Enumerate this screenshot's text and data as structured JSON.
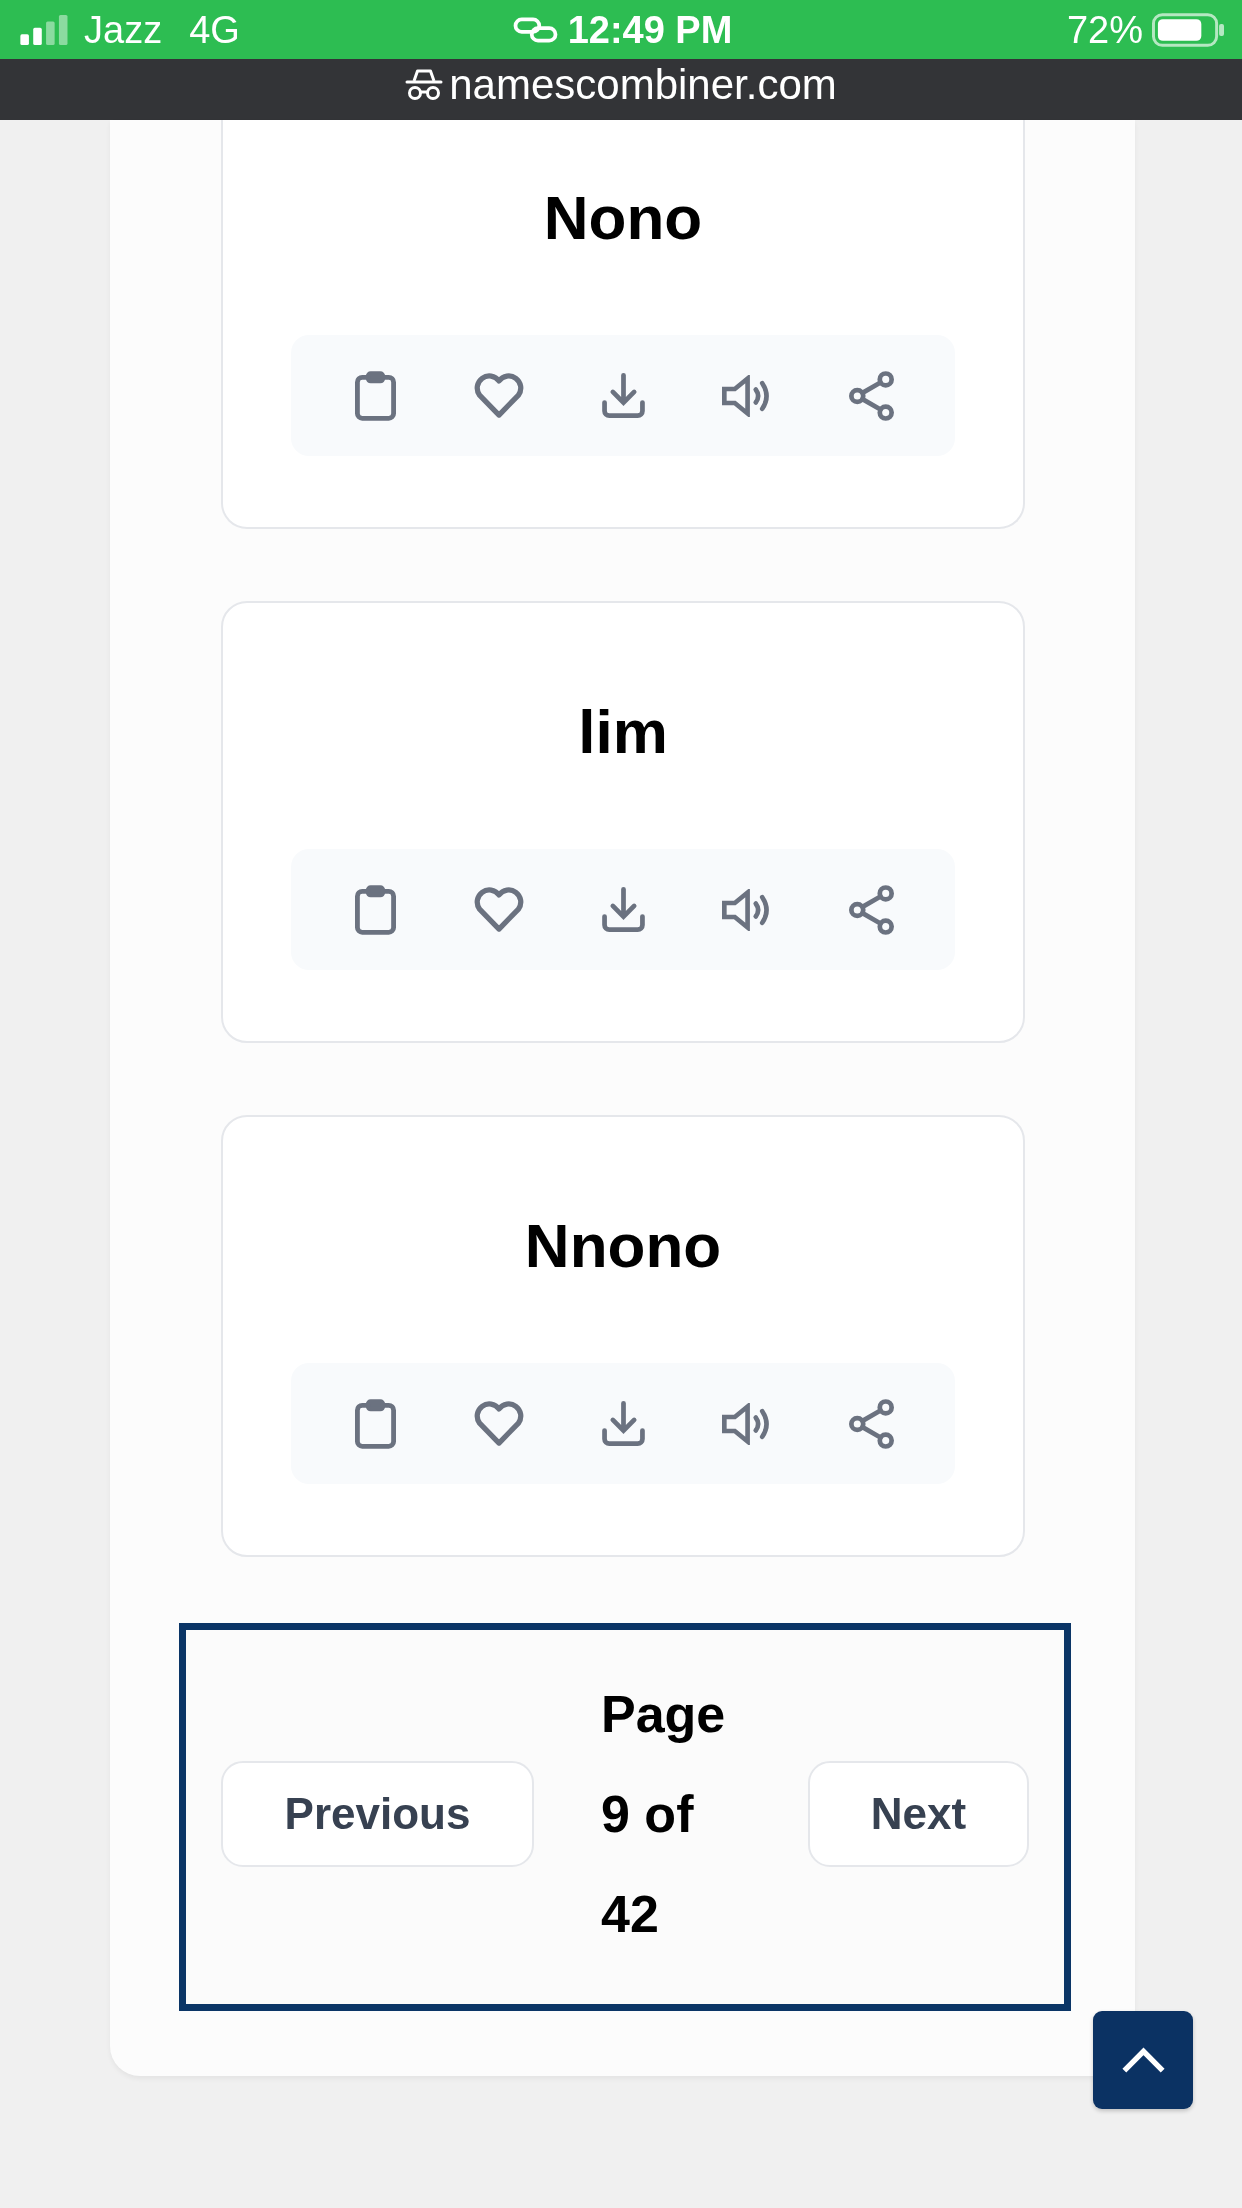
{
  "status_bar": {
    "carrier": "Jazz",
    "network": "4G",
    "time": "12:49 PM",
    "battery": "72%"
  },
  "address_bar": {
    "url": "namescombiner.com"
  },
  "name_cards": [
    {
      "name": "Nono"
    },
    {
      "name": "lim"
    },
    {
      "name": "Nnono"
    }
  ],
  "pagination": {
    "previous": "Previous",
    "page_indicator": "Page 9 of 42",
    "next": "Next"
  }
}
